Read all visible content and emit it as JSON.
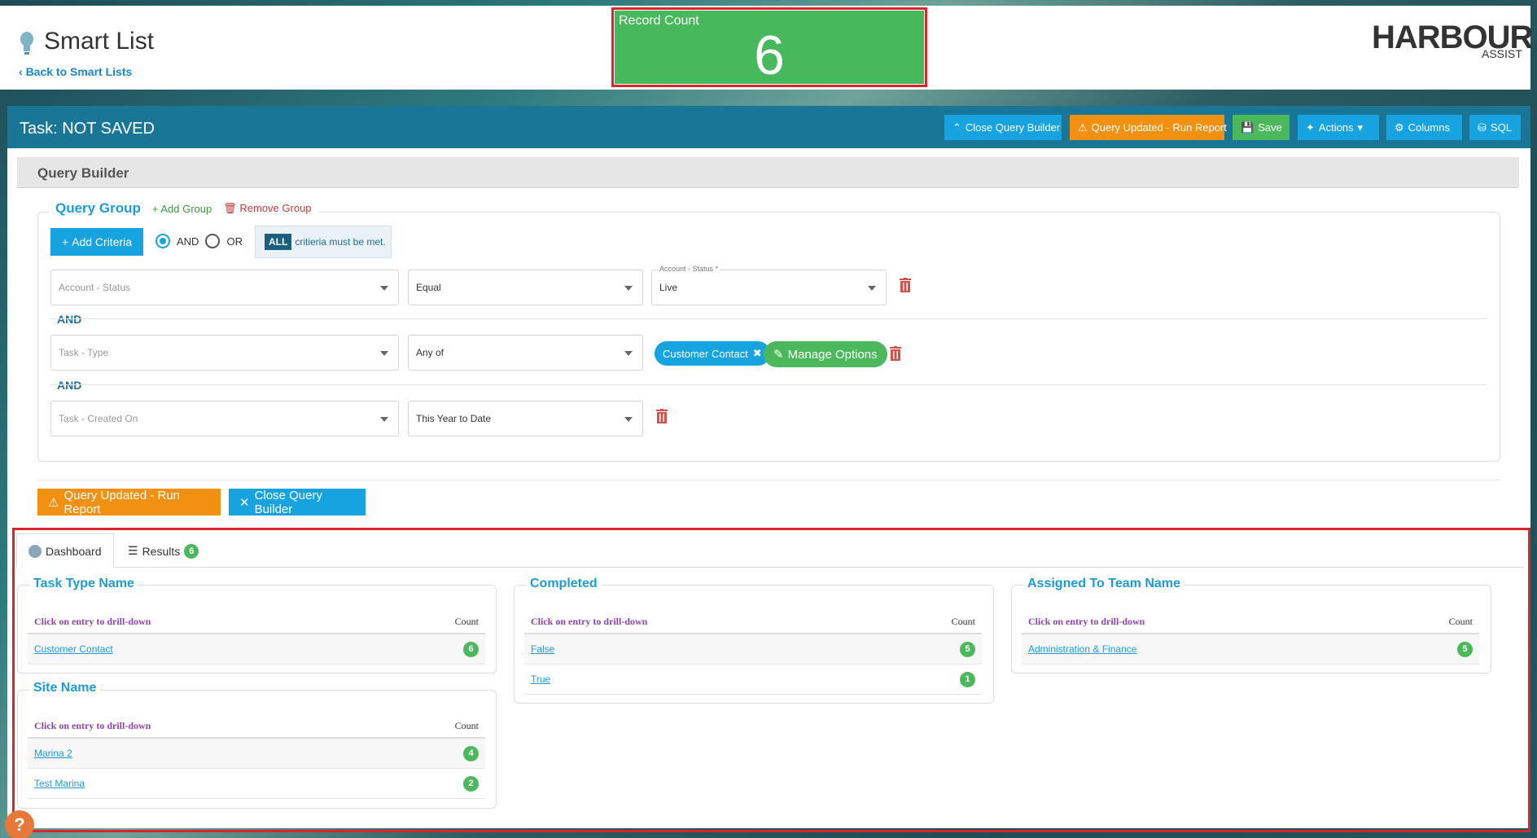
{
  "header": {
    "title": "Smart List",
    "back_label": "Back to Smart Lists",
    "record_count_label": "Record Count",
    "record_count_value": "6",
    "logo_main": "HARBOUR",
    "logo_sub": "ASSIST"
  },
  "toolbar": {
    "task_title": "Task: NOT SAVED",
    "close_query_builder": "Close Query Builder",
    "query_updated": "Query Updated - Run Report",
    "save": "Save",
    "actions": "Actions",
    "columns": "Columns",
    "sql": "SQL"
  },
  "query_builder": {
    "title": "Query Builder",
    "group_title": "Query Group",
    "add_group": "Add Group",
    "remove_group": "Remove Group",
    "add_criteria": "Add Criteria",
    "and_label": "AND",
    "or_label": "OR",
    "mode_selected": "AND",
    "all_tag": "ALL",
    "all_text": "critieria must be met.",
    "connector": "AND",
    "criteria": [
      {
        "field": "Account - Status",
        "operator": "Equal",
        "value_label": "Account - Status *",
        "value": "Live"
      },
      {
        "field": "Task - Type",
        "operator": "Any of",
        "chip": "Customer Contact",
        "manage": "Manage Options"
      },
      {
        "field": "Task - Created On",
        "operator": "This Year to Date"
      }
    ],
    "run_report": "Query Updated - Run Report",
    "close": "Close Query Builder"
  },
  "tabs": {
    "dashboard": "Dashboard",
    "results": "Results",
    "results_count": "6"
  },
  "cards": {
    "drill_label": "Click on entry to drill-down",
    "count_label": "Count",
    "task_type": {
      "title": "Task Type Name",
      "rows": [
        {
          "label": "Customer Contact",
          "count": "6"
        }
      ]
    },
    "completed": {
      "title": "Completed",
      "rows": [
        {
          "label": "False",
          "count": "5"
        },
        {
          "label": "True",
          "count": "1"
        }
      ]
    },
    "team": {
      "title": "Assigned To Team Name",
      "rows": [
        {
          "label": "Administration & Finance",
          "count": "5"
        }
      ]
    },
    "site": {
      "title": "Site Name",
      "rows": [
        {
          "label": "Marina 2",
          "count": "4"
        },
        {
          "label": "Test Marina",
          "count": "2"
        }
      ]
    }
  },
  "colors": {
    "accent_blue": "#16a3e0",
    "teal_bar": "#1a7696",
    "green": "#4cb85c",
    "orange": "#f29111",
    "highlight_red": "#d9262c"
  }
}
